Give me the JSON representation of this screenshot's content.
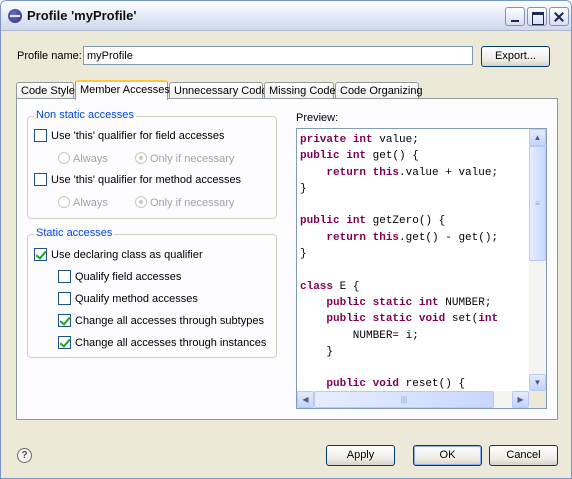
{
  "window": {
    "title": "Profile 'myProfile'",
    "controls": [
      "minimize-icon",
      "maximize-icon",
      "close-icon"
    ]
  },
  "profile": {
    "label": "Profile name:",
    "value": "myProfile",
    "export_label": "Export..."
  },
  "tabs": [
    {
      "label": "Code Style",
      "active": false
    },
    {
      "label": "Member Accesses",
      "active": true
    },
    {
      "label": "Unnecessary Code",
      "active": false
    },
    {
      "label": "Missing Code",
      "active": false
    },
    {
      "label": "Code Organizing",
      "active": false
    }
  ],
  "non_static": {
    "title": "Non static accesses",
    "field_checkbox": {
      "label": "Use 'this' qualifier for field accesses",
      "checked": false
    },
    "field_radios": [
      {
        "label": "Always",
        "selected": false,
        "enabled": false
      },
      {
        "label": "Only if necessary",
        "selected": true,
        "enabled": false
      }
    ],
    "method_checkbox": {
      "label": "Use 'this' qualifier for method accesses",
      "checked": false
    },
    "method_radios": [
      {
        "label": "Always",
        "selected": false,
        "enabled": false
      },
      {
        "label": "Only if necessary",
        "selected": true,
        "enabled": false
      }
    ]
  },
  "static": {
    "title": "Static accesses",
    "declaring": {
      "label": "Use declaring class as qualifier",
      "checked": true
    },
    "qualify_field": {
      "label": "Qualify field accesses",
      "checked": false
    },
    "qualify_method": {
      "label": "Qualify method accesses",
      "checked": false
    },
    "subtypes": {
      "label": "Change all accesses through subtypes",
      "checked": true
    },
    "instances": {
      "label": "Change all accesses through instances",
      "checked": true
    }
  },
  "preview": {
    "label": "Preview:",
    "lines": [
      "private int value;",
      "public int get() {",
      "    return this.value + value;",
      "}",
      "",
      "public int getZero() {",
      "    return this.get() - get();",
      "}",
      "",
      "class E {",
      "    public static int NUMBER;",
      "    public static void set(int",
      "        NUMBER= i;",
      "    }",
      "",
      "    public void reset() {"
    ]
  },
  "buttons": {
    "apply": "Apply",
    "ok": "OK",
    "cancel": "Cancel"
  },
  "help_icon": "?"
}
